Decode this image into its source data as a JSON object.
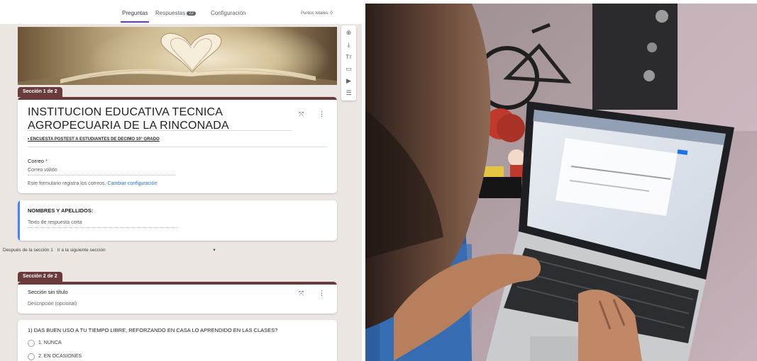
{
  "nav": {
    "tabs": [
      "Preguntas",
      "Respuestas",
      "Configuración"
    ],
    "responses_count": "22",
    "points": "Puntos totales: 0"
  },
  "section1": {
    "tab_label": "Sección 1 de 2",
    "title": "INSTITUCION EDUCATIVA TECNICA AGROPECUARIA DE LA RINCONADA",
    "description": "ENCUESTA POSTEST A ESTUDIANTES DE DECIMO 10° GRADO",
    "email_label": "Correo",
    "email_required": "*",
    "email_placeholder": "Correo válido",
    "email_note": "Este formulario registra los correos.",
    "email_link": "Cambiar configuración"
  },
  "question_name": {
    "label": "NOMBRES Y APELLIDOS:",
    "placeholder": "Texto de respuesta corta"
  },
  "after_section": {
    "prefix": "Después de la sección 1",
    "action": "Ir a la siguiente sección",
    "arrow": "▾"
  },
  "section2": {
    "tab_label": "Sección 2 de 2",
    "title": "Sección sin título",
    "description": "Descripción (opcional)"
  },
  "question1": {
    "text": "1) DAS BUEN USO A TU TIEMPO LIBRE, REFORZANDO EN CASA LO APRENDIDO EN LAS CLASES?",
    "options": [
      "1. NUNCA",
      "2. EN OCASIONES"
    ]
  },
  "icons": {
    "collapse": "⤧",
    "more": "⋮",
    "tools": [
      "⊕",
      "⤓",
      "Tт",
      "▭",
      "▶",
      "☰"
    ]
  },
  "colors": {
    "section_accent": "#6b3a3a",
    "focus_bar": "#4285f4",
    "link": "#1a73e8",
    "tab_underline": "#673ab7"
  }
}
